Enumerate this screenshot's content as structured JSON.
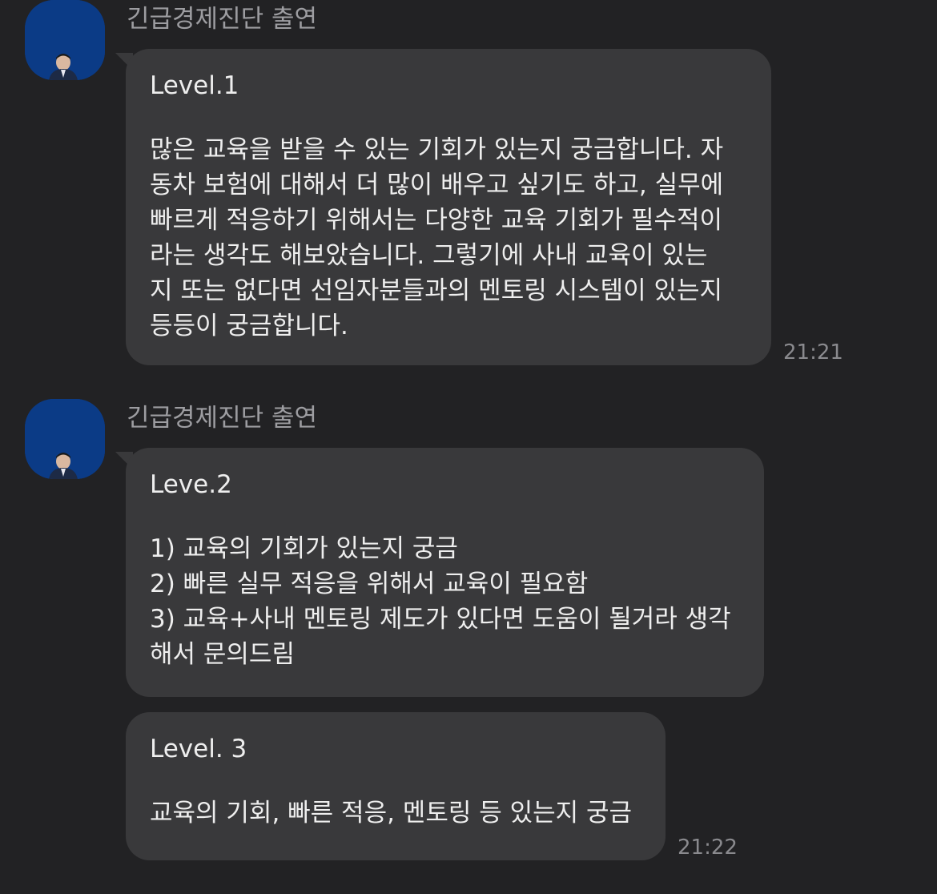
{
  "groups": [
    {
      "sender": "긴급경제진단 출연",
      "messages": [
        {
          "title": "Level.1",
          "lines": [
            "많은 교육을 받을 수 있는 기회가 있는지 궁금합니다. 자",
            "동차 보험에 대해서 더 많이 배우고 싶기도 하고, 실무에",
            "빠르게 적응하기 위해서는 다양한 교육 기회가 필수적이",
            "라는 생각도 해보았습니다. 그렇기에 사내 교육이 있는",
            "지 또는 없다면 선임자분들과의 멘토링 시스템이 있는지",
            "등등이 궁금합니다."
          ],
          "time": "21:21"
        }
      ]
    },
    {
      "sender": "긴급경제진단 출연",
      "messages": [
        {
          "title": "Leve.2",
          "lines": [
            "1) 교육의 기회가 있는지 궁금",
            "2) 빠른 실무 적응을 위해서 교육이 필요함",
            "3) 교육+사내 멘토링 제도가 있다면 도움이 될거라 생각",
            "해서 문의드림"
          ],
          "time": ""
        },
        {
          "title": "Level. 3",
          "lines": [
            "교육의 기회, 빠른 적응, 멘토링 등 있는지 궁금"
          ],
          "time": "21:22"
        }
      ]
    }
  ],
  "colors": {
    "background": "#222224",
    "bubble": "#39393b",
    "avatar": "#0b3b86"
  }
}
